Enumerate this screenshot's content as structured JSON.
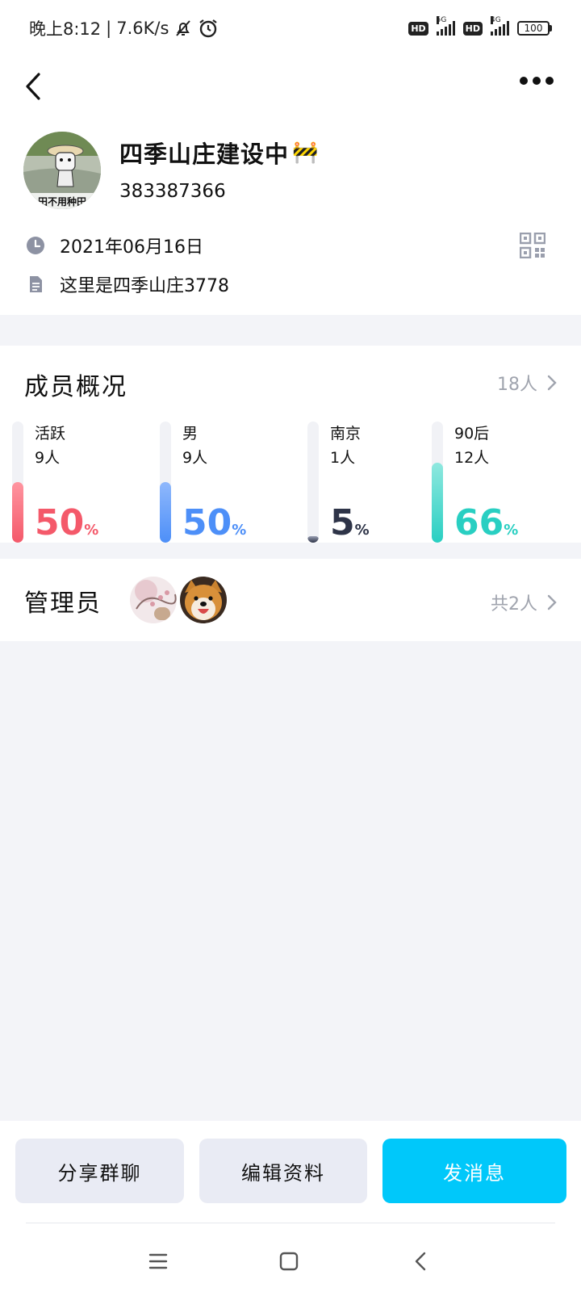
{
  "status_bar": {
    "time": "晚上8:12",
    "speed": "7.6K/s",
    "net1": "5G",
    "net2": "4G",
    "hd": "HD",
    "battery": "100"
  },
  "header": {
    "back_icon": "chevron-left-icon",
    "more_icon": "more-dots-icon"
  },
  "group": {
    "name": "四季山庄建设中",
    "name_emoji": "🚧",
    "id": "383387366",
    "avatar_caption": "田不用种田",
    "created_date": "2021年06月16日",
    "description": "这里是四季山庄3778"
  },
  "members": {
    "title": "成员概况",
    "total": "18人",
    "stats": [
      {
        "label": "活跃",
        "count": "9人",
        "percent": "50",
        "unit": "%",
        "level": 0.5,
        "color": "#f4596a",
        "color_light": "#ff95a0"
      },
      {
        "label": "男",
        "count": "9人",
        "percent": "50",
        "unit": "%",
        "level": 0.5,
        "color": "#4d8ff8",
        "color_light": "#8fb8fc"
      },
      {
        "label": "南京",
        "count": "1人",
        "percent": "5",
        "unit": "%",
        "level": 0.05,
        "color": "#2e3448",
        "color_light": "#9aa0b4"
      },
      {
        "label": "90后",
        "count": "12人",
        "percent": "66",
        "unit": "%",
        "level": 0.66,
        "color": "#29cfc2",
        "color_light": "#8fe8df"
      }
    ]
  },
  "admins": {
    "title": "管理员",
    "total": "共2人"
  },
  "actions": {
    "share": "分享群聊",
    "edit": "编辑资料",
    "message": "发消息"
  },
  "colors": {
    "accent": "#00c8fa",
    "background": "#f3f4f8",
    "muted_text": "#a0a4ae"
  }
}
